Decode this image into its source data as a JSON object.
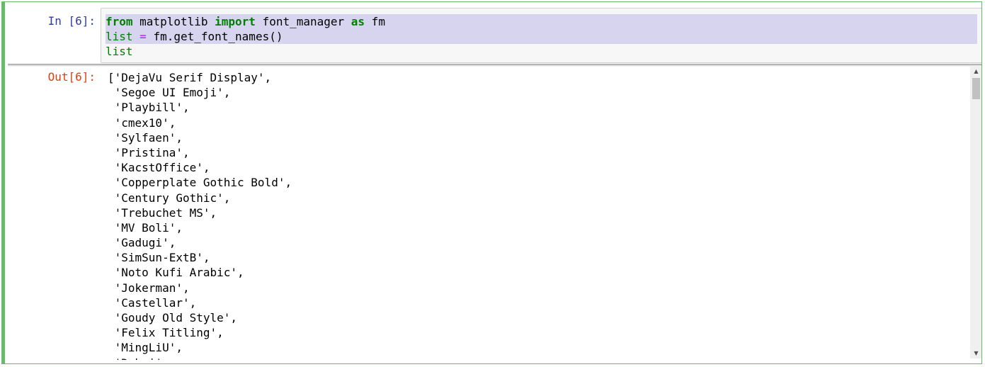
{
  "cell": {
    "in_prompt": "In [6]:",
    "out_prompt": "Out[6]:",
    "code": {
      "line1": {
        "kw1": "from",
        "t1": " matplotlib ",
        "kw2": "import",
        "t2": " font_manager ",
        "kw3": "as",
        "t3": " fm"
      },
      "line2": {
        "var": "list",
        "sp": " ",
        "op": "=",
        "rest": " fm.get_font_names()"
      },
      "line3": {
        "var": "list"
      }
    },
    "output_lines": [
      "['DejaVu Serif Display',",
      " 'Segoe UI Emoji',",
      " 'Playbill',",
      " 'cmex10',",
      " 'Sylfaen',",
      " 'Pristina',",
      " 'KacstOffice',",
      " 'Copperplate Gothic Bold',",
      " 'Century Gothic',",
      " 'Trebuchet MS',",
      " 'MV Boli',",
      " 'Gadugi',",
      " 'SimSun-ExtB',",
      " 'Noto Kufi Arabic',",
      " 'Jokerman',",
      " 'Castellar',",
      " 'Goudy Old Style',",
      " 'Felix Titling',",
      " 'MingLiU',",
      " 'Dubai',"
    ]
  },
  "scrollbar": {
    "up_icon": "▲",
    "down_icon": "▼"
  },
  "colors": {
    "selected_border": "#66bb6a",
    "in_prompt": "#303f9f",
    "out_prompt": "#d84315",
    "keyword": "#008000",
    "operator": "#aa22ff",
    "selection": "#d7d4f0"
  }
}
